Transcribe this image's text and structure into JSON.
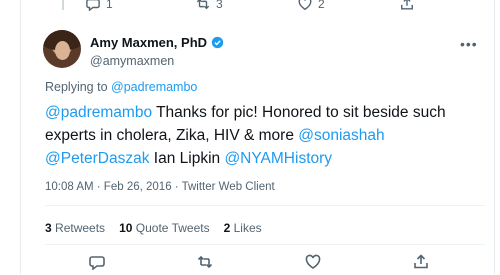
{
  "top_actions": {
    "reply_count": "1",
    "retweet_count": "3",
    "like_count": "2"
  },
  "author": {
    "display_name": "Amy Maxmen, PhD",
    "handle": "@amymaxmen"
  },
  "reply_to": {
    "prefix": "Replying to",
    "mention": "@padremambo"
  },
  "tweet": {
    "seg1": "@padremambo",
    "seg2": " Thanks for pic! Honored to sit beside such experts in cholera, Zika, HIV & more ",
    "seg3": "@soniashah",
    "seg4": "@PeterDaszak",
    "seg5": " Ian Lipkin ",
    "seg6": "@NYAMHistory"
  },
  "meta": {
    "time": "10:08 AM · Feb 26, 2016 · Twitter Web Client"
  },
  "stats": {
    "retweets_num": "3",
    "retweets_label": "Retweets",
    "quotes_num": "10",
    "quotes_label": "Quote Tweets",
    "likes_num": "2",
    "likes_label": "Likes"
  },
  "colors": {
    "link": "#1d9bf0",
    "muted": "#536471",
    "text": "#0f1419"
  }
}
